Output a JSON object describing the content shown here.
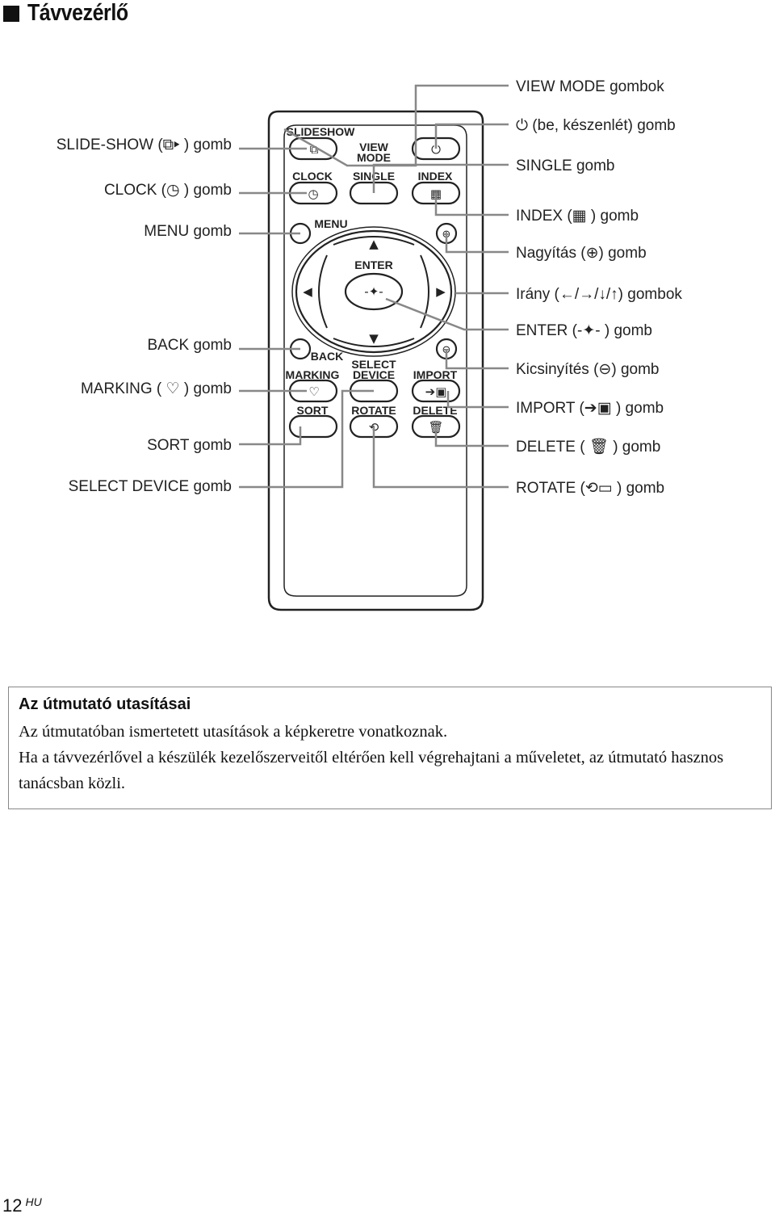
{
  "title": "Távvezérlő",
  "remote": {
    "buttons": {
      "slideshow": "SLIDESHOW",
      "view_mode_1": "VIEW",
      "view_mode_2": "MODE",
      "clock": "CLOCK",
      "single": "SINGLE",
      "index": "INDEX",
      "menu": "MENU",
      "enter": "ENTER",
      "back": "BACK",
      "select_1": "SELECT",
      "select_2": "DEVICE",
      "marking": "MARKING",
      "import": "IMPORT",
      "sort": "SORT",
      "rotate": "ROTATE",
      "delete": "DELETE"
    }
  },
  "callouts": {
    "left": [
      "SLIDE-SHOW (⧉▸ ) gomb",
      "CLOCK (◷ ) gomb",
      "MENU gomb",
      "BACK gomb",
      "MARKING ( ♡ ) gomb",
      "SORT gomb",
      "SELECT DEVICE gomb"
    ],
    "right": [
      "VIEW MODE gombok",
      "⏻ (be, készenlét) gomb",
      "SINGLE gomb",
      "INDEX (▦ ) gomb",
      "Nagyítás (⊕) gomb",
      "Irány (←/→/↓/↑) gombok",
      "ENTER (-✦- ) gomb",
      "Kicsinyítés (⊖) gomb",
      "IMPORT (➔▣ ) gomb",
      "DELETE ( 🗑 ) gomb",
      "ROTATE (⟲▭ ) gomb"
    ]
  },
  "note": {
    "heading": "Az útmutató utasításai",
    "line1": "Az útmutatóban ismertetett utasítások a képkeretre vonatkoznak.",
    "line2": "Ha a távvezérlővel a készülék kezelőszerveitől eltérően kell végrehajtani a műveletet, az útmutató hasznos tanácsban közli."
  },
  "footer": {
    "page": "12",
    "lang": "HU"
  }
}
